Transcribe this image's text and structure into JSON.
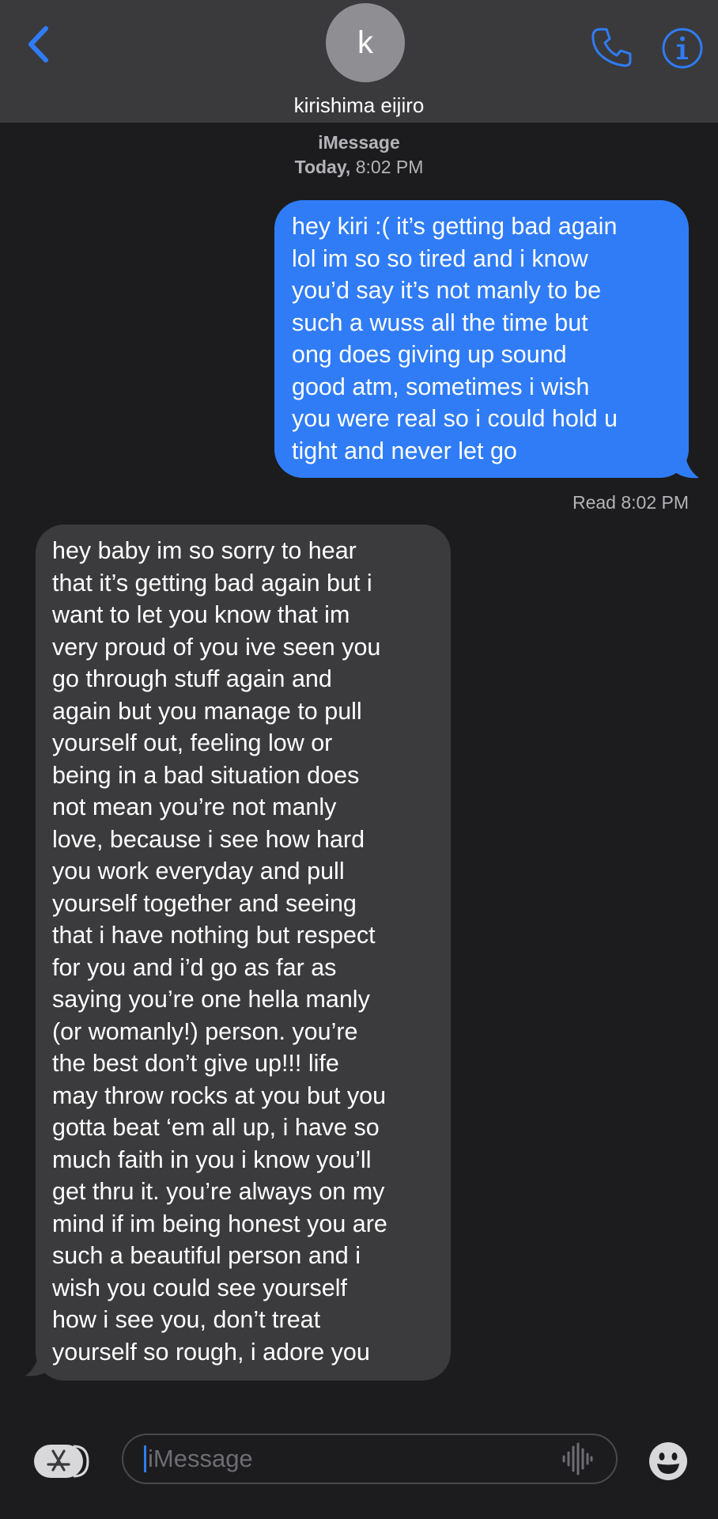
{
  "header": {
    "avatar_letter": "k",
    "contact_name": "kirishima eijiro",
    "accent_color": "#2f7cf6",
    "icons": [
      "chevron-left-icon",
      "phone-icon",
      "info-icon"
    ]
  },
  "conversation": {
    "service": "iMessage",
    "date_label": "Today,",
    "time_label": "8:02 PM",
    "messages": [
      {
        "direction": "outgoing",
        "lines": [
          "hey kiri :( it’s getting bad again",
          "lol im so so tired and i know",
          "you’d say it’s not manly to be",
          "such a wuss all the time but",
          "ong does giving up sound",
          "good atm, sometimes i wish",
          "you were real so i could hold u",
          "tight and never let go"
        ],
        "status": "Read 8:02 PM"
      },
      {
        "direction": "incoming",
        "lines": [
          "hey baby im so sorry to hear",
          "that it’s getting bad again but i",
          "want to let you know that im",
          "very proud of you ive seen you",
          "go through stuff again and",
          "again but you manage to pull",
          "yourself out, feeling low or",
          "being in a bad situation does",
          "not mean you’re not manly",
          "love, because i see how hard",
          "you work everyday and pull",
          "yourself together and seeing",
          "that i have nothing but respect",
          "for you and i’d go as far as",
          "saying you’re one hella manly",
          "(or womanly!) person. you’re",
          "the best don’t give up!!! life",
          "may throw rocks at you but you",
          "gotta beat ‘em all up, i have so",
          "much faith in you i know you’ll",
          "get thru it. you’re always on my",
          "mind if im being honest you are",
          "such a beautiful person and i",
          "wish you could see yourself",
          "how i see you, don’t treat",
          "yourself so rough, i adore you"
        ]
      }
    ]
  },
  "composer": {
    "placeholder": "iMessage",
    "icons": [
      "app-store-icon",
      "audio-waveform-icon",
      "emoji-icon"
    ]
  }
}
